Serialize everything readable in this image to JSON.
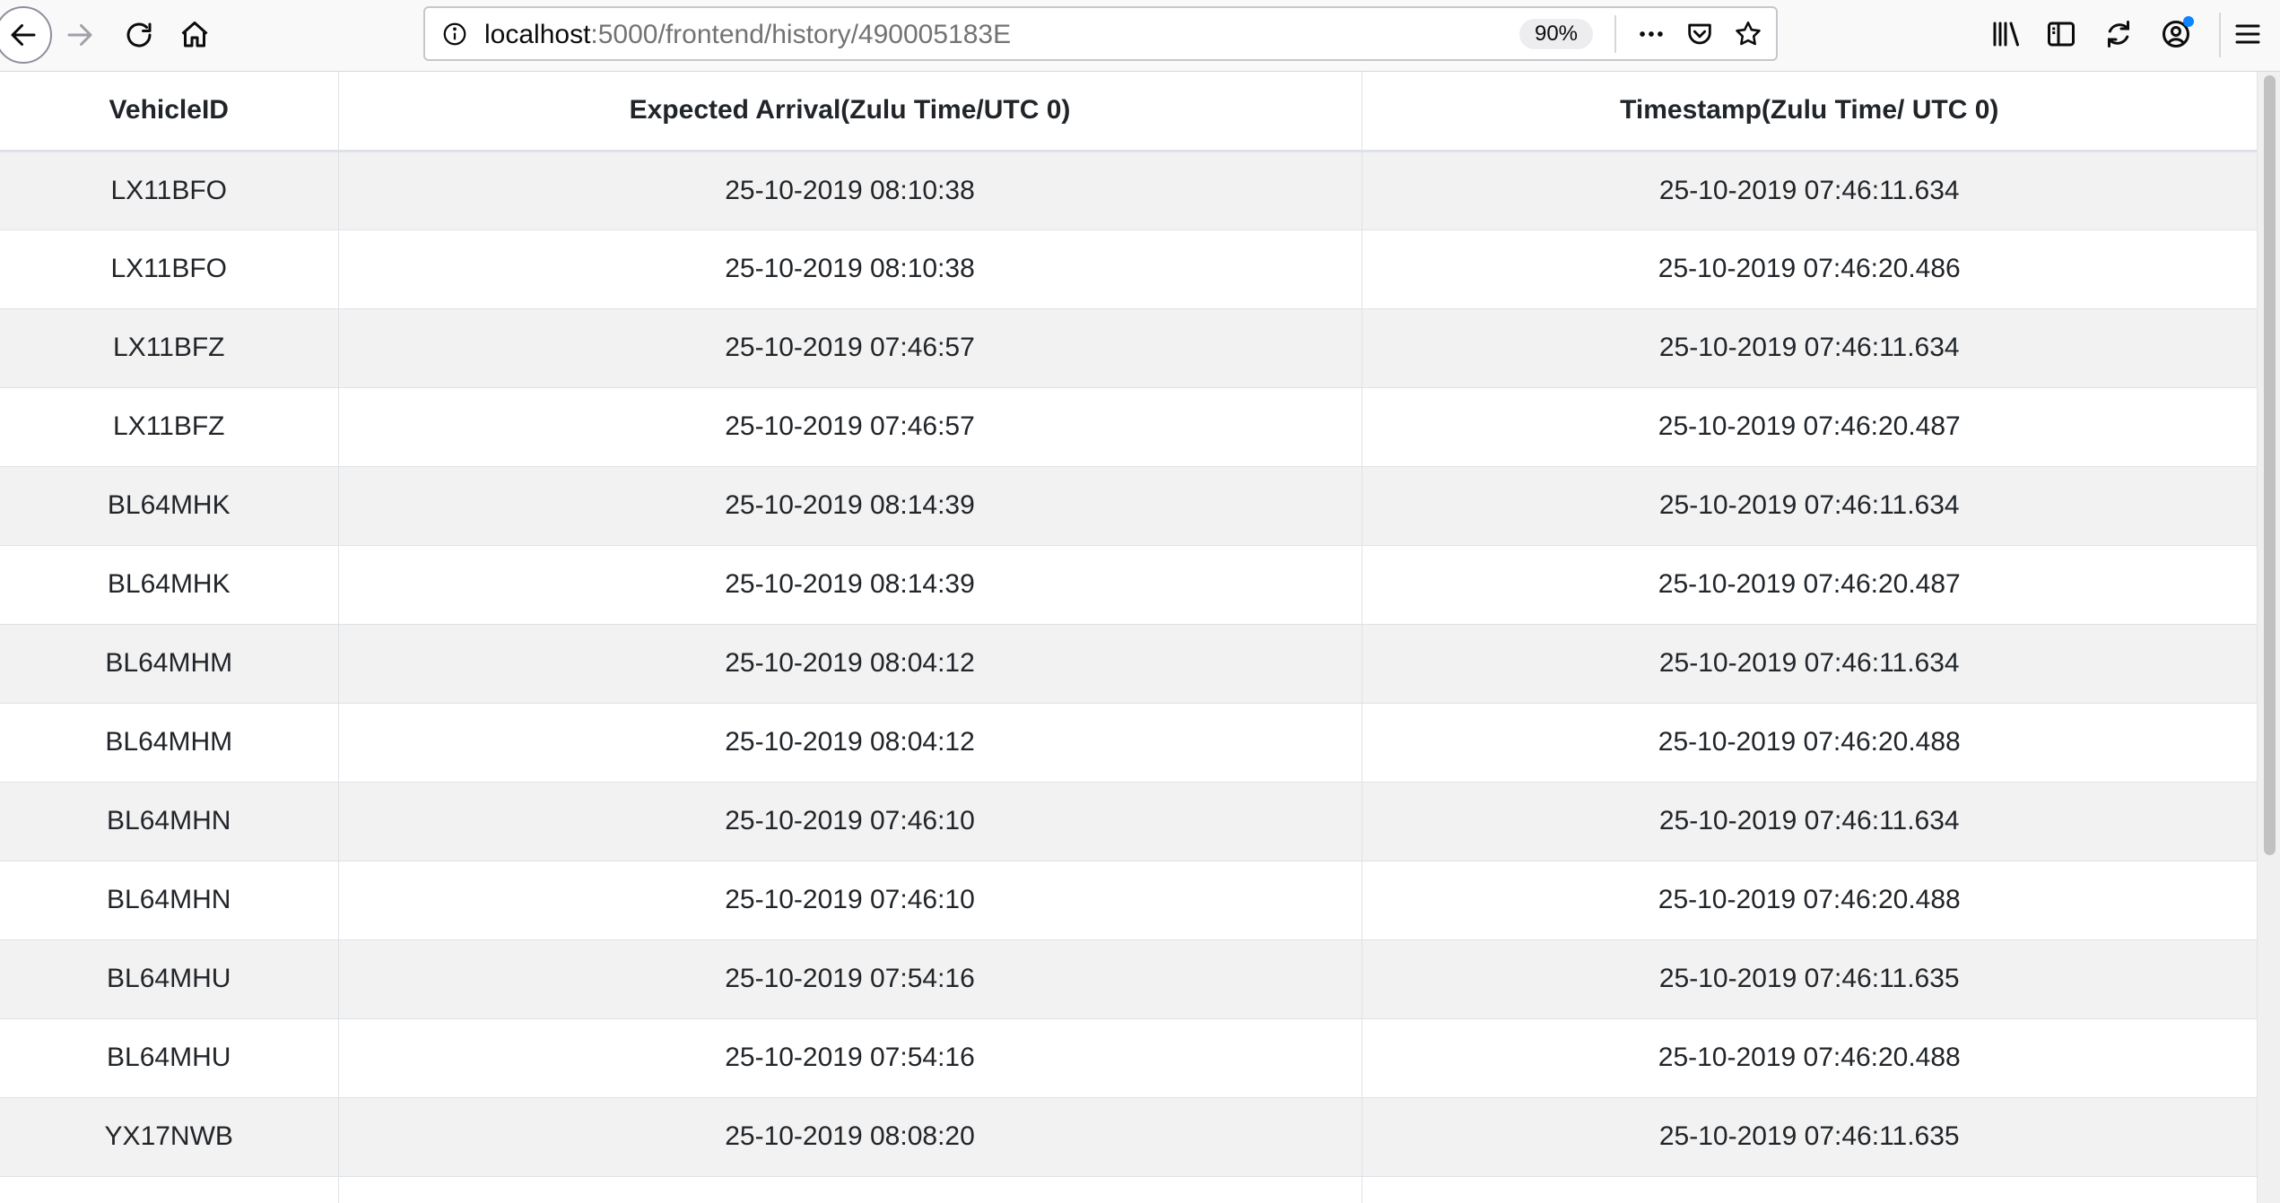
{
  "browser": {
    "url_host": "localhost",
    "url_path": ":5000/frontend/history/490005183E",
    "zoom": "90%",
    "icons": {
      "back": "back-arrow-icon",
      "forward": "forward-arrow-icon",
      "reload": "reload-icon",
      "home": "home-icon",
      "info": "info-icon",
      "page_actions": "more-dots-icon",
      "pocket": "pocket-icon",
      "bookmark": "star-icon",
      "library": "library-icon",
      "sidebar": "sidebar-icon",
      "sync": "sync-icon",
      "account": "account-icon",
      "menu": "hamburger-menu-icon"
    }
  },
  "table": {
    "headers": [
      "VehicleID",
      "Expected Arrival(Zulu Time/UTC 0)",
      "Timestamp(Zulu Time/ UTC 0)"
    ],
    "rows": [
      [
        "LX11BFO",
        "25-10-2019 08:10:38",
        "25-10-2019 07:46:11.634"
      ],
      [
        "LX11BFO",
        "25-10-2019 08:10:38",
        "25-10-2019 07:46:20.486"
      ],
      [
        "LX11BFZ",
        "25-10-2019 07:46:57",
        "25-10-2019 07:46:11.634"
      ],
      [
        "LX11BFZ",
        "25-10-2019 07:46:57",
        "25-10-2019 07:46:20.487"
      ],
      [
        "BL64MHK",
        "25-10-2019 08:14:39",
        "25-10-2019 07:46:11.634"
      ],
      [
        "BL64MHK",
        "25-10-2019 08:14:39",
        "25-10-2019 07:46:20.487"
      ],
      [
        "BL64MHM",
        "25-10-2019 08:04:12",
        "25-10-2019 07:46:11.634"
      ],
      [
        "BL64MHM",
        "25-10-2019 08:04:12",
        "25-10-2019 07:46:20.488"
      ],
      [
        "BL64MHN",
        "25-10-2019 07:46:10",
        "25-10-2019 07:46:11.634"
      ],
      [
        "BL64MHN",
        "25-10-2019 07:46:10",
        "25-10-2019 07:46:20.488"
      ],
      [
        "BL64MHU",
        "25-10-2019 07:54:16",
        "25-10-2019 07:46:11.635"
      ],
      [
        "BL64MHU",
        "25-10-2019 07:54:16",
        "25-10-2019 07:46:20.488"
      ],
      [
        "YX17NWB",
        "25-10-2019 08:08:20",
        "25-10-2019 07:46:11.635"
      ],
      [
        "",
        "",
        ""
      ]
    ]
  },
  "colors": {
    "stripe": "#f2f2f2",
    "border": "#dee2e6",
    "account_dot": "#0a84ff"
  }
}
